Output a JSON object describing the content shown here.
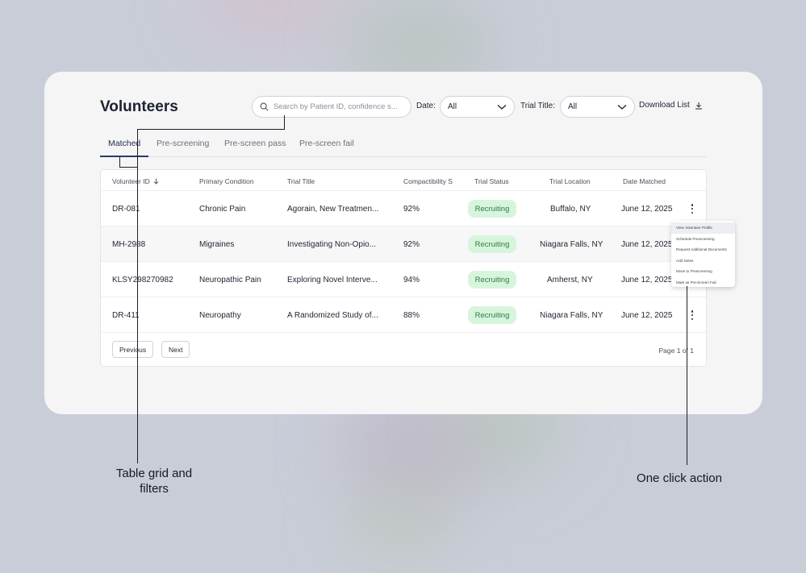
{
  "header": {
    "title": "Volunteers",
    "search_placeholder": "Search by Patient ID, confidence s...",
    "date_label": "Date:",
    "date_value": "All",
    "trial_label": "Trial Title:",
    "trial_value": "All",
    "download_label": "Download List"
  },
  "tabs": [
    {
      "label": "Matched",
      "active": true
    },
    {
      "label": "Pre-screening"
    },
    {
      "label": "Pre-screen pass"
    },
    {
      "label": "Pre-screen fail"
    }
  ],
  "table": {
    "columns": [
      "Volunteer ID",
      "Primary Condition",
      "Trial Title",
      "Compactibility S",
      "Trial Status",
      "Trial Location",
      "Date Matched"
    ],
    "rows": [
      {
        "id": "DR-081",
        "condition": "Chronic Pain",
        "trial": "Agorain, New Treatmen...",
        "score": "92%",
        "status": "Recruiting",
        "location": "Buffalo, NY",
        "date": "June 12, 2025"
      },
      {
        "id": "MH-2988",
        "condition": "Migraines",
        "trial": "Investigating Non-Opio...",
        "score": "92%",
        "status": "Recruiting",
        "location": "Niagara Falls, NY",
        "date": "June 12, 2025"
      },
      {
        "id": "KLSY298270982",
        "condition": "Neuropathic Pain",
        "trial": "Exploring Novel Interve...",
        "score": "94%",
        "status": "Recruiting",
        "location": "Amherst, NY",
        "date": "June 12, 2025"
      },
      {
        "id": "DR-411",
        "condition": "Neuropathy",
        "trial": "A Randomized Study of...",
        "score": "88%",
        "status": "Recruiting",
        "location": "Niagara Falls, NY",
        "date": "June 12, 2025"
      }
    ],
    "prev_label": "Previous",
    "next_label": "Next",
    "page_info": "Page 1 of 1"
  },
  "menu": [
    "View Volunteer Profile",
    "Schedule Prescreening",
    "Request Additional Documents",
    "Add Notes",
    "Move to Prescreening",
    "Mark as Pre-Screen Fail"
  ],
  "callouts": {
    "left_line1": "Table grid and",
    "left_line2": "filters",
    "right": "One click action"
  },
  "colors": {
    "status_bg": "#d7f5dd",
    "status_text": "#2a7d43",
    "active_tab": "#2b3a66"
  }
}
